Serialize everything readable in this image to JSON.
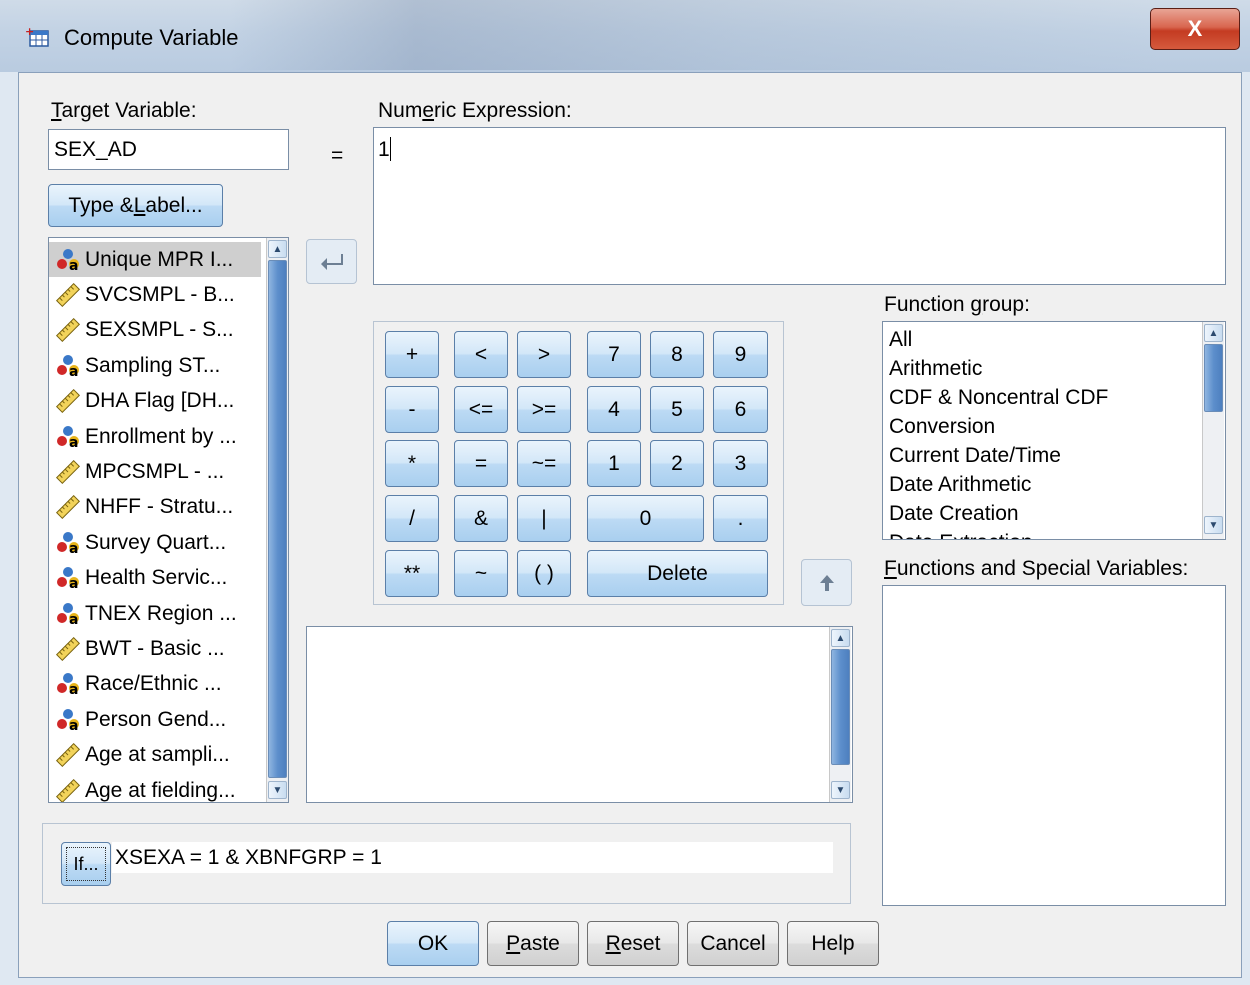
{
  "window": {
    "title": "Compute Variable",
    "close_label": "X"
  },
  "target": {
    "label_prefix": "T",
    "label_rest": "arget Variable:",
    "value": "SEX_AD"
  },
  "equals": "=",
  "type_label_button": {
    "prefix": "Type & ",
    "underlined": "L",
    "rest": "abel..."
  },
  "numeric_expression": {
    "label_prefix": "Num",
    "label_underlined": "e",
    "label_rest": "ric Expression:",
    "value": "1"
  },
  "variables": [
    {
      "label": "Unique MPR I...",
      "type": "nominal"
    },
    {
      "label": "SVCSMPL - B...",
      "type": "scale"
    },
    {
      "label": "SEXSMPL - S...",
      "type": "scale"
    },
    {
      "label": "Sampling ST...",
      "type": "nominal"
    },
    {
      "label": "DHA Flag [DH...",
      "type": "scale"
    },
    {
      "label": "Enrollment by ...",
      "type": "nominal"
    },
    {
      "label": "MPCSMPL - ...",
      "type": "scale"
    },
    {
      "label": "NHFF - Stratu...",
      "type": "scale"
    },
    {
      "label": "Survey Quart...",
      "type": "nominal"
    },
    {
      "label": "Health Servic...",
      "type": "nominal"
    },
    {
      "label": "TNEX Region ...",
      "type": "nominal"
    },
    {
      "label": "BWT - Basic ...",
      "type": "scale"
    },
    {
      "label": "Race/Ethnic ...",
      "type": "nominal"
    },
    {
      "label": "Person Gend...",
      "type": "nominal"
    },
    {
      "label": "Age at sampli...",
      "type": "scale"
    },
    {
      "label": "Age at fielding...",
      "type": "scale"
    }
  ],
  "keypad": {
    "plus": "+",
    "lt": "<",
    "gt": ">",
    "k7": "7",
    "k8": "8",
    "k9": "9",
    "minus": "-",
    "le": "<=",
    "ge": ">=",
    "k4": "4",
    "k5": "5",
    "k6": "6",
    "times": "*",
    "eq": "=",
    "ne": "~=",
    "k1": "1",
    "k2": "2",
    "k3": "3",
    "div": "/",
    "and": "&",
    "or": "|",
    "k0": "0",
    "dot": ".",
    "pow": "**",
    "not": "~",
    "parens": "( )",
    "delete": "Delete"
  },
  "function_group": {
    "label_prefix": "Function ",
    "label_underlined": "g",
    "label_rest": "roup:",
    "items": [
      "All",
      "Arithmetic",
      "CDF & Noncentral CDF",
      "Conversion",
      "Current Date/Time",
      "Date Arithmetic",
      "Date Creation",
      "Date Extraction"
    ]
  },
  "functions_special": {
    "label_underlined": "F",
    "label_rest": "unctions and Special Variables:"
  },
  "if_section": {
    "button_label": "If...",
    "condition": "XSEXA = 1 & XBNFGRP = 1"
  },
  "footer": {
    "ok": "OK",
    "paste_u": "P",
    "paste_rest": "aste",
    "reset_u": "R",
    "reset_rest": "eset",
    "cancel": "Cancel",
    "help": "Help"
  },
  "colors": {
    "accent": "#5b7fa8",
    "close": "#c43b22",
    "scroll_thumb": "#5d8fcc"
  }
}
